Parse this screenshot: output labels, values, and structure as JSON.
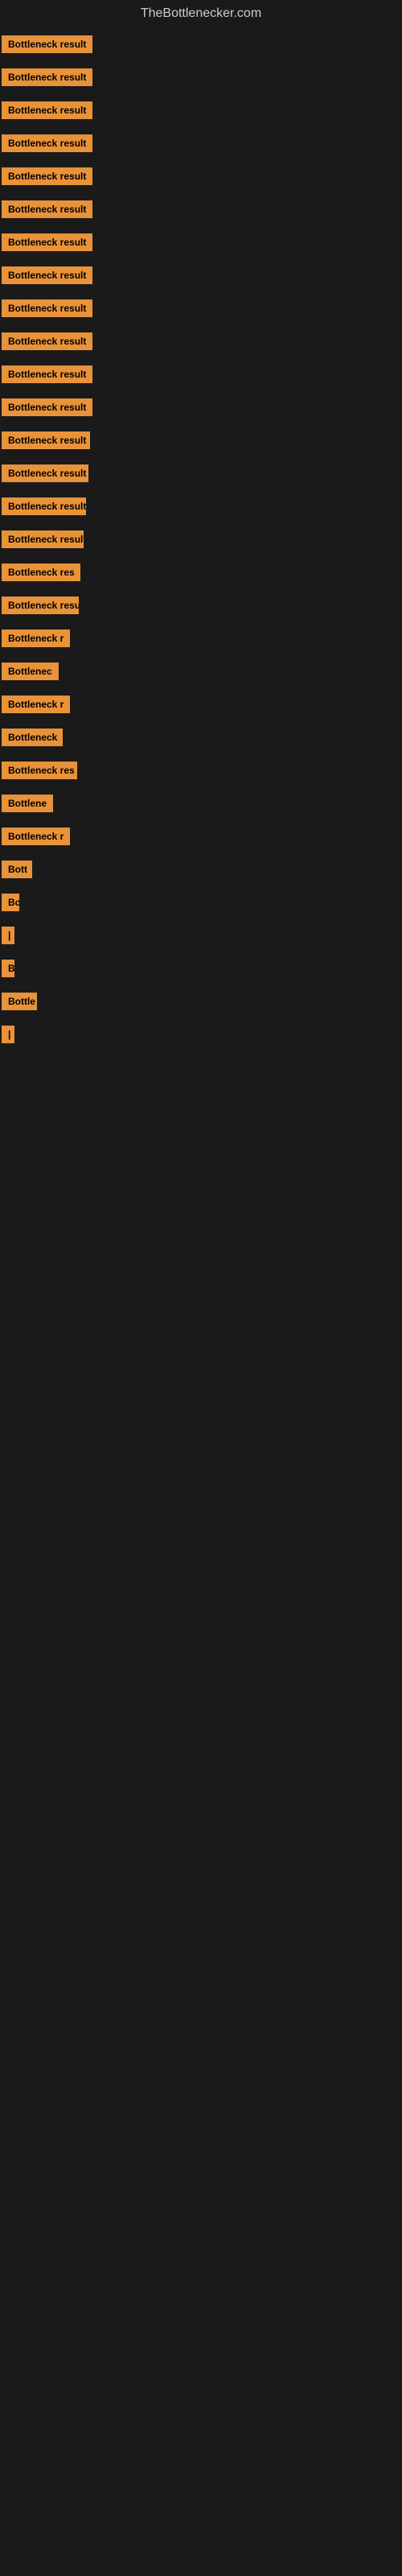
{
  "site": {
    "title": "TheBottlenecker.com"
  },
  "items": [
    {
      "id": 1,
      "label": "Bottleneck result",
      "width": 145
    },
    {
      "id": 2,
      "label": "Bottleneck result",
      "width": 140
    },
    {
      "id": 3,
      "label": "Bottleneck result",
      "width": 135
    },
    {
      "id": 4,
      "label": "Bottleneck result",
      "width": 130
    },
    {
      "id": 5,
      "label": "Bottleneck result",
      "width": 130
    },
    {
      "id": 6,
      "label": "Bottleneck result",
      "width": 128
    },
    {
      "id": 7,
      "label": "Bottleneck result",
      "width": 125
    },
    {
      "id": 8,
      "label": "Bottleneck result",
      "width": 122
    },
    {
      "id": 9,
      "label": "Bottleneck result",
      "width": 120
    },
    {
      "id": 10,
      "label": "Bottleneck result",
      "width": 118
    },
    {
      "id": 11,
      "label": "Bottleneck result",
      "width": 116
    },
    {
      "id": 12,
      "label": "Bottleneck result",
      "width": 113
    },
    {
      "id": 13,
      "label": "Bottleneck result",
      "width": 110
    },
    {
      "id": 14,
      "label": "Bottleneck result",
      "width": 108
    },
    {
      "id": 15,
      "label": "Bottleneck result",
      "width": 105
    },
    {
      "id": 16,
      "label": "Bottleneck result",
      "width": 102
    },
    {
      "id": 17,
      "label": "Bottleneck res",
      "width": 98
    },
    {
      "id": 18,
      "label": "Bottleneck result",
      "width": 96
    },
    {
      "id": 19,
      "label": "Bottleneck r",
      "width": 90
    },
    {
      "id": 20,
      "label": "Bottlenec",
      "width": 80
    },
    {
      "id": 21,
      "label": "Bottleneck r",
      "width": 88
    },
    {
      "id": 22,
      "label": "Bottleneck",
      "width": 76
    },
    {
      "id": 23,
      "label": "Bottleneck res",
      "width": 94
    },
    {
      "id": 24,
      "label": "Bottlene",
      "width": 68
    },
    {
      "id": 25,
      "label": "Bottleneck r",
      "width": 85
    },
    {
      "id": 26,
      "label": "Bott",
      "width": 38
    },
    {
      "id": 27,
      "label": "Bo",
      "width": 22
    },
    {
      "id": 28,
      "label": "|",
      "width": 10
    },
    {
      "id": 29,
      "label": "B",
      "width": 16
    },
    {
      "id": 30,
      "label": "Bottle",
      "width": 44
    },
    {
      "id": 31,
      "label": "|",
      "width": 10
    }
  ],
  "colors": {
    "badge_bg": "#e8923a",
    "badge_text": "#000000",
    "background": "#1a1a1a",
    "title_text": "#cccccc"
  }
}
